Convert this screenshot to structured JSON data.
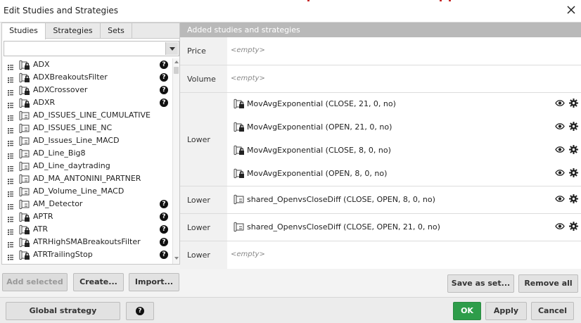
{
  "window": {
    "title": "Edit Studies and Strategies",
    "close_icon": "close-icon"
  },
  "tabs": [
    {
      "label": "Studies",
      "active": true
    },
    {
      "label": "Strategies",
      "active": false
    },
    {
      "label": "Sets",
      "active": false
    }
  ],
  "search": {
    "value": "",
    "placeholder": ""
  },
  "studies": [
    {
      "name": "ADX",
      "locked": true,
      "help": true
    },
    {
      "name": "ADXBreakoutsFilter",
      "locked": true,
      "help": true
    },
    {
      "name": "ADXCrossover",
      "locked": true,
      "help": true
    },
    {
      "name": "ADXR",
      "locked": true,
      "help": true
    },
    {
      "name": "AD_ISSUES_LINE_CUMULATIVE",
      "locked": false,
      "help": false
    },
    {
      "name": "AD_ISSUES_LINE_NC",
      "locked": false,
      "help": false
    },
    {
      "name": "AD_Issues_Line_MACD",
      "locked": false,
      "help": false
    },
    {
      "name": "AD_Line_Big8",
      "locked": false,
      "help": false
    },
    {
      "name": "AD_Line_daytrading",
      "locked": false,
      "help": false
    },
    {
      "name": "AD_MA_ANTONINI_PARTNER",
      "locked": false,
      "help": false
    },
    {
      "name": "AD_Volume_Line_MACD",
      "locked": false,
      "help": false
    },
    {
      "name": "AM_Detector",
      "locked": false,
      "help": true
    },
    {
      "name": "APTR",
      "locked": true,
      "help": true
    },
    {
      "name": "ATR",
      "locked": true,
      "help": true
    },
    {
      "name": "ATRHighSMABreakoutsFilter",
      "locked": true,
      "help": true
    },
    {
      "name": "ATRTrailingStop",
      "locked": true,
      "help": true
    }
  ],
  "help_glyph": "?",
  "left_buttons": {
    "add_selected": "Add selected",
    "create": "Create...",
    "import": "Import..."
  },
  "right": {
    "header": "Added studies and strategies",
    "empty_text": "<empty>",
    "groups": [
      {
        "label": "Price",
        "items": []
      },
      {
        "label": "Volume",
        "items": []
      },
      {
        "label": "Lower",
        "items": [
          {
            "text": "MovAvgExponential (CLOSE, 21, 0, no)",
            "locked": true
          },
          {
            "text": "MovAvgExponential (OPEN, 21, 0, no)",
            "locked": true
          },
          {
            "text": "MovAvgExponential (CLOSE, 8, 0, no)",
            "locked": true
          },
          {
            "text": "MovAvgExponential (OPEN, 8, 0, no)",
            "locked": true
          }
        ]
      },
      {
        "label": "Lower",
        "items": [
          {
            "text": "shared_OpenvsCloseDiff (CLOSE, OPEN, 8, 0, no)",
            "locked": false
          }
        ]
      },
      {
        "label": "Lower",
        "items": [
          {
            "text": "shared_OpenvsCloseDiff (CLOSE, OPEN, 21, 0, no)",
            "locked": false
          }
        ]
      },
      {
        "label": "Lower",
        "items": []
      }
    ],
    "save_as_set": "Save as set...",
    "remove_all": "Remove all"
  },
  "bottom": {
    "global_settings": "Global strategy settings...",
    "help": "?",
    "ok": "OK",
    "apply": "Apply",
    "cancel": "Cancel"
  },
  "colors": {
    "accent_red": "#c62828",
    "ok_green": "#2e9d4a",
    "header_gray": "#b9b9b9"
  }
}
